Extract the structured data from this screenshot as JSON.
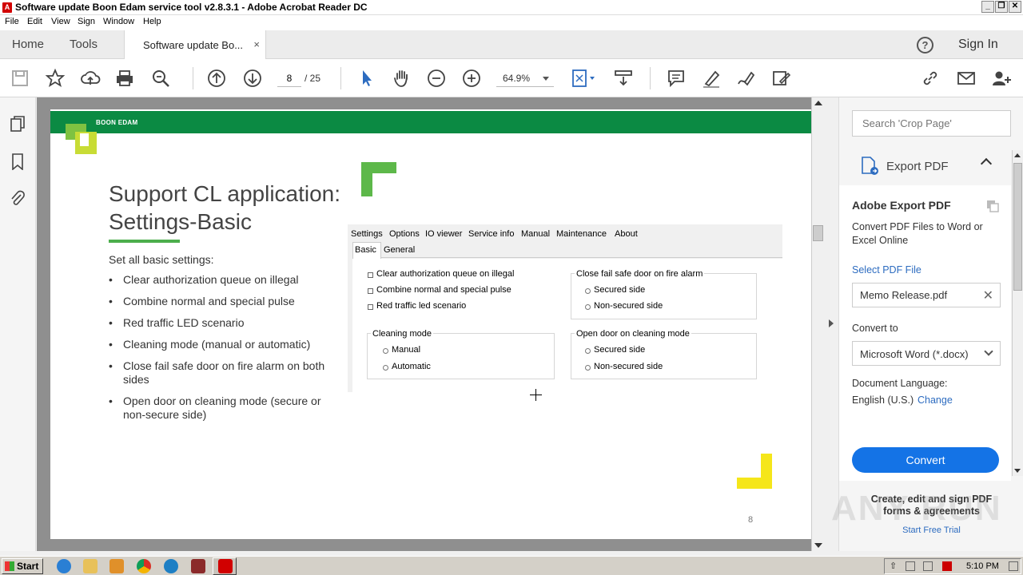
{
  "window": {
    "title": "Software update Boon Edam service tool v2.8.3.1 - Adobe Acrobat Reader DC",
    "minimize": "_",
    "restore": "❐",
    "close": "✕"
  },
  "menubar": [
    "File",
    "Edit",
    "View",
    "Sign",
    "Window",
    "Help"
  ],
  "tabs": {
    "home": "Home",
    "tools": "Tools",
    "document": "Software update Bo...",
    "close": "×",
    "help": "?",
    "signin": "Sign In"
  },
  "toolbar": {
    "page_number": "8",
    "page_total": "/ 25",
    "zoom": "64.9%"
  },
  "slide": {
    "brand": "BOON EDAM",
    "title_line1": "Support CL application:",
    "title_line2": "Settings-Basic",
    "intro": "Set all basic settings:",
    "bullets": [
      "Clear authorization queue on illegal",
      "Combine normal and special pulse",
      "Red traffic LED scenario",
      "Cleaning mode (manual or automatic)",
      "Close fail safe door on fire alarm on both sides",
      "Open door on cleaning mode (secure or non-secure side)"
    ],
    "page_number": "8",
    "colors": {
      "green_band": "#0b8a43",
      "accent_green": "#4cae4c",
      "yellow": "#f5e61a",
      "lime": "#c8dc35"
    }
  },
  "screenshot": {
    "menu": [
      "Settings",
      "Options",
      "IO viewer",
      "Service info",
      "Manual",
      "Maintenance",
      "About"
    ],
    "subtabs": [
      "Basic",
      "General"
    ],
    "checkboxes": [
      "Clear authorization queue on illegal",
      "Combine normal and special pulse",
      "Red traffic led scenario"
    ],
    "fire_alarm": {
      "title": "Close fail safe door on fire alarm",
      "options": [
        "Secured side",
        "Non-secured side"
      ]
    },
    "cleaning_mode": {
      "title": "Cleaning mode",
      "options": [
        "Manual",
        "Automatic"
      ]
    },
    "open_door": {
      "title": "Open door on cleaning mode",
      "options": [
        "Secured side",
        "Non-secured side"
      ]
    }
  },
  "right_panel": {
    "search_placeholder": "Search 'Crop Page'",
    "export_header": "Export PDF",
    "export_title": "Adobe Export PDF",
    "export_desc": "Convert PDF Files to Word or Excel Online",
    "select_pdf": "Select PDF File",
    "selected_file": "Memo Release.pdf",
    "convert_to_label": "Convert to",
    "format": "Microsoft Word (*.docx)",
    "doc_language_label": "Document Language:",
    "language": "English (U.S.)",
    "change": "Change",
    "convert_button": "Convert",
    "promo": "Create, edit and sign PDF forms & agreements",
    "promo_link": "Start Free Trial",
    "accent_color": "#1473e6"
  },
  "watermark": "ANY RUN",
  "taskbar": {
    "start": "Start",
    "clock": "5:10 PM"
  }
}
